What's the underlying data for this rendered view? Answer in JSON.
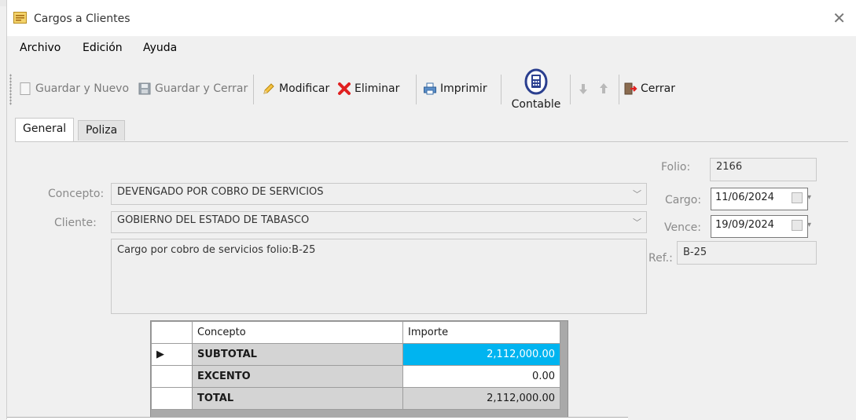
{
  "window": {
    "title": "Cargos a Clientes"
  },
  "menu": [
    "Archivo",
    "Edición",
    "Ayuda"
  ],
  "toolbar": {
    "guardar_nuevo": "Guardar y Nuevo",
    "guardar_cerrar": "Guardar y Cerrar",
    "modificar": "Modificar",
    "eliminar": "Eliminar",
    "imprimir": "Imprimir",
    "contable": "Contable",
    "cerrar": "Cerrar"
  },
  "tabs": [
    "General",
    "Poliza"
  ],
  "form": {
    "folio_label": "Folio:",
    "folio": "2166",
    "concepto_label": "Concepto:",
    "concepto": "DEVENGADO POR COBRO DE SERVICIOS",
    "cargo_label": "Cargo:",
    "cargo": "11/06/2024",
    "cliente_label": "Cliente:",
    "cliente": "GOBIERNO DEL ESTADO DE TABASCO",
    "vence_label": "Vence:",
    "vence": "19/09/2024",
    "descripcion": "Cargo por cobro de servicios folio:B-25",
    "ref_label": "Ref.:",
    "ref": "B-25"
  },
  "grid": {
    "columns": [
      "Concepto",
      "Importe"
    ],
    "rows": [
      {
        "concepto": "SUBTOTAL",
        "importe": "2,112,000.00"
      },
      {
        "concepto": "EXCENTO",
        "importe": "0.00"
      },
      {
        "concepto": "TOTAL",
        "importe": "2,112,000.00"
      }
    ]
  },
  "colors": {
    "highlight": "#00b4f0",
    "delete": "#e02020"
  }
}
